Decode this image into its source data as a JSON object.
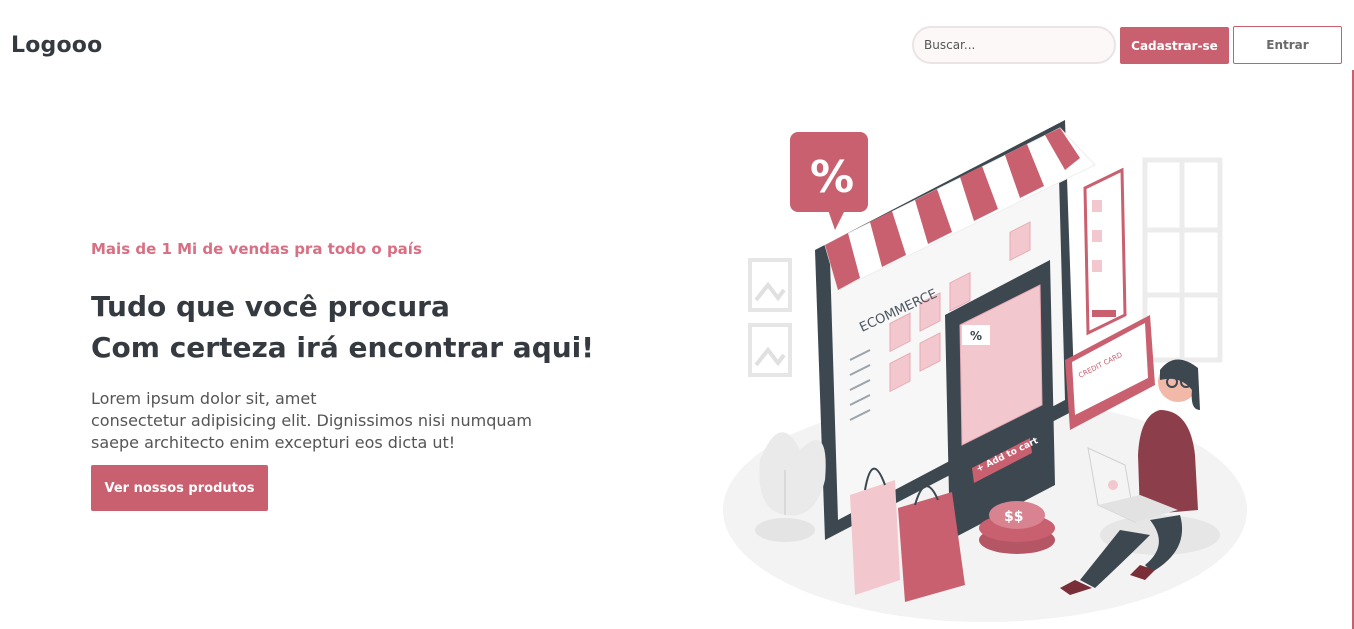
{
  "header": {
    "logo": "Logooo",
    "search_placeholder": "Buscar...",
    "signup_label": "Cadastrar-se",
    "login_label": "Entrar"
  },
  "hero": {
    "eyebrow": "Mais de 1 Mi de vendas pra todo o país",
    "headline_line1": "Tudo que você procura",
    "headline_line2": "Com certeza irá encontrar aqui!",
    "lead_line1": "Lorem ipsum dolor sit, amet",
    "lead_line2": "consectetur adipisicing elit. Dignissimos nisi numquam",
    "lead_line3": "saepe architecto enim excepturi eos dicta ut!",
    "cta_label": "Ver nossos produtos"
  },
  "illustration": {
    "ecommerce_word": "ECOMMERCE",
    "percent": "%",
    "add_to_cart": "+ Add to cart",
    "credit_card": "CREDIT CARD",
    "price_tag": "$$"
  },
  "colors": {
    "accent": "#c9606f",
    "accent_light": "#d86f82",
    "text_dark": "#343a40",
    "illustration_dark": "#3c4750"
  }
}
